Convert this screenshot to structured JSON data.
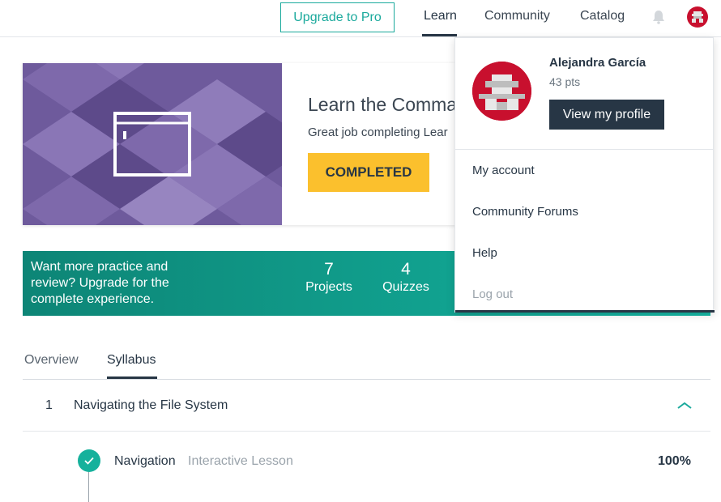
{
  "nav": {
    "upgrade_label": "Upgrade to Pro",
    "links": [
      "Learn",
      "Community",
      "Catalog"
    ],
    "active": "Learn"
  },
  "hero": {
    "title": "Learn the Comma",
    "subtitle": "Great job completing Lear",
    "button_label": "COMPLETED"
  },
  "banner": {
    "text": "Want more practice and review? Upgrade for the complete experience.",
    "stats": [
      {
        "value": "7",
        "label": "Projects"
      },
      {
        "value": "4",
        "label": "Quizzes"
      }
    ]
  },
  "tabs": {
    "items": [
      "Overview",
      "Syllabus"
    ],
    "active": "Syllabus"
  },
  "syllabus": {
    "module_number": "1",
    "module_title": "Navigating the File System",
    "lesson": {
      "title": "Navigation",
      "type": "Interactive Lesson",
      "progress": "100%"
    }
  },
  "dropdown": {
    "user_name": "Alejandra García",
    "points": "43 pts",
    "profile_button": "View my profile",
    "menu": [
      "My account",
      "Community Forums",
      "Help",
      "Log out"
    ]
  },
  "colors": {
    "teal": "#1aa99c",
    "navy": "#273645",
    "yellow": "#fbc02d",
    "avatar_red": "#c8102e",
    "hero_purple": "#6e5a9c"
  },
  "icons": [
    "bell-icon",
    "avatar-icon",
    "chevron-up-icon",
    "check-icon",
    "window-icon"
  ]
}
